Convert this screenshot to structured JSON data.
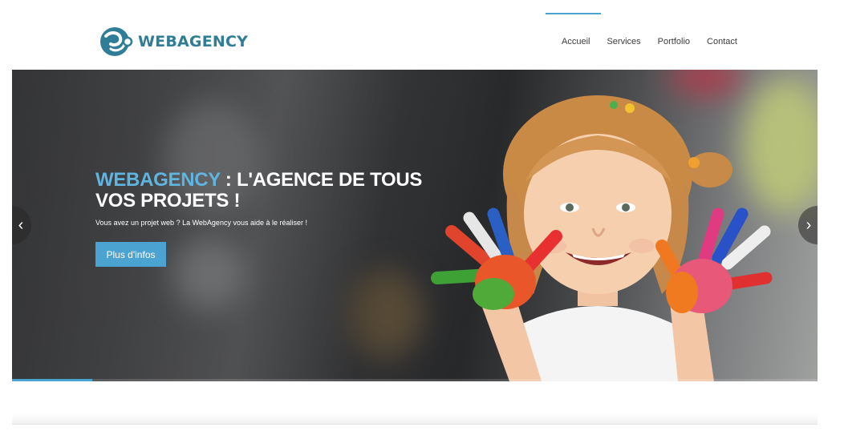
{
  "brand": {
    "name": "WEBAGENCY",
    "color": "#2f7d96",
    "logo_icon": "logo-swirl-icon"
  },
  "nav": {
    "items": [
      {
        "label": "Accueil",
        "active": true
      },
      {
        "label": "Services",
        "active": false
      },
      {
        "label": "Portfolio",
        "active": false
      },
      {
        "label": "Contact",
        "active": false
      }
    ],
    "accent_color": "#4aa3d0"
  },
  "hero": {
    "title_accent": "WEBAGENCY",
    "title_rest": " : L'AGENCE DE TOUS VOS PROJETS !",
    "subtitle": "Vous avez un projet web ? La WebAgency vous aide à le réaliser !",
    "button_label": "Plus d'infos",
    "prev_icon": "chevron-left-icon",
    "next_icon": "chevron-right-icon",
    "slide_progress": 0.1
  }
}
